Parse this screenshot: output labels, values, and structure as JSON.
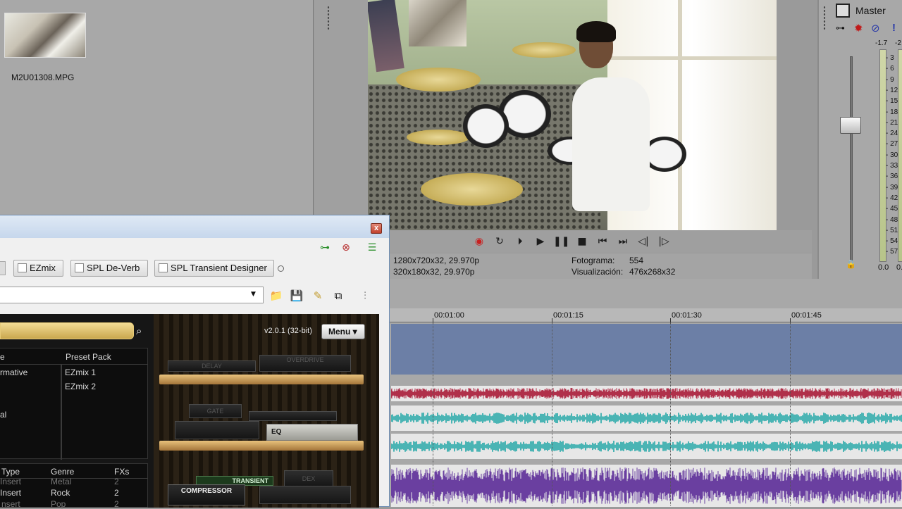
{
  "media": {
    "thumbnail_name": "M2U01308.MPG"
  },
  "transport": {
    "buttons": [
      "record-icon",
      "loop-icon",
      "play-from-start-icon",
      "play-icon",
      "pause-icon",
      "stop-icon",
      "prev-marker-icon",
      "next-marker-icon",
      "prev-frame-icon",
      "next-frame-icon"
    ]
  },
  "preview": {
    "project_line": "1280x720x32, 29.970p",
    "preview_line": "320x180x32, 29.970p",
    "frame_label": "Fotograma:",
    "frame_value": "554",
    "display_label": "Visualización:",
    "display_value": "476x268x32"
  },
  "master": {
    "title": "Master",
    "peak_left": "-1.7",
    "peak_right": "-2",
    "level_left": "0.0",
    "level_right": "0.",
    "scale": [
      "3",
      "6",
      "9",
      "12",
      "15",
      "18",
      "21",
      "24",
      "27",
      "30",
      "33",
      "36",
      "39",
      "42",
      "45",
      "48",
      "51",
      "54",
      "57"
    ]
  },
  "timeline": {
    "ruler": [
      "00:01:00",
      "00:01:15",
      "00:01:30",
      "00:01:45"
    ]
  },
  "plugin": {
    "close_label": "x",
    "chain": [
      "EZmix",
      "SPL De-Verb",
      "SPL Transient Designer"
    ],
    "ezmix": {
      "version": "v2.0.1 (32-bit)",
      "menu_label": "Menu ▾",
      "list1_headers": [
        "e",
        "Preset Pack"
      ],
      "list1_col1": [
        "rmative",
        "",
        "",
        "al",
        ""
      ],
      "list1_col2": [
        "EZmix 1",
        "EZmix 2"
      ],
      "list2_headers": [
        "Type",
        "Genre",
        "FXs"
      ],
      "list2_rows": [
        [
          "Insert",
          "Metal",
          "2"
        ],
        [
          "Insert",
          "Rock",
          "2"
        ],
        [
          "nsert",
          "Pop",
          "2"
        ]
      ],
      "rack_labels": [
        "DELAY",
        "OVERDRIVE",
        "GATE",
        "EQ",
        "TRANSIENT",
        "COMPRESSOR",
        "DEX"
      ]
    }
  },
  "colors": {
    "video_track": "#6c7fa6",
    "wave_red": "#b0304a",
    "wave_teal": "#4ab4b4",
    "wave_purple": "#6a3fa0"
  }
}
